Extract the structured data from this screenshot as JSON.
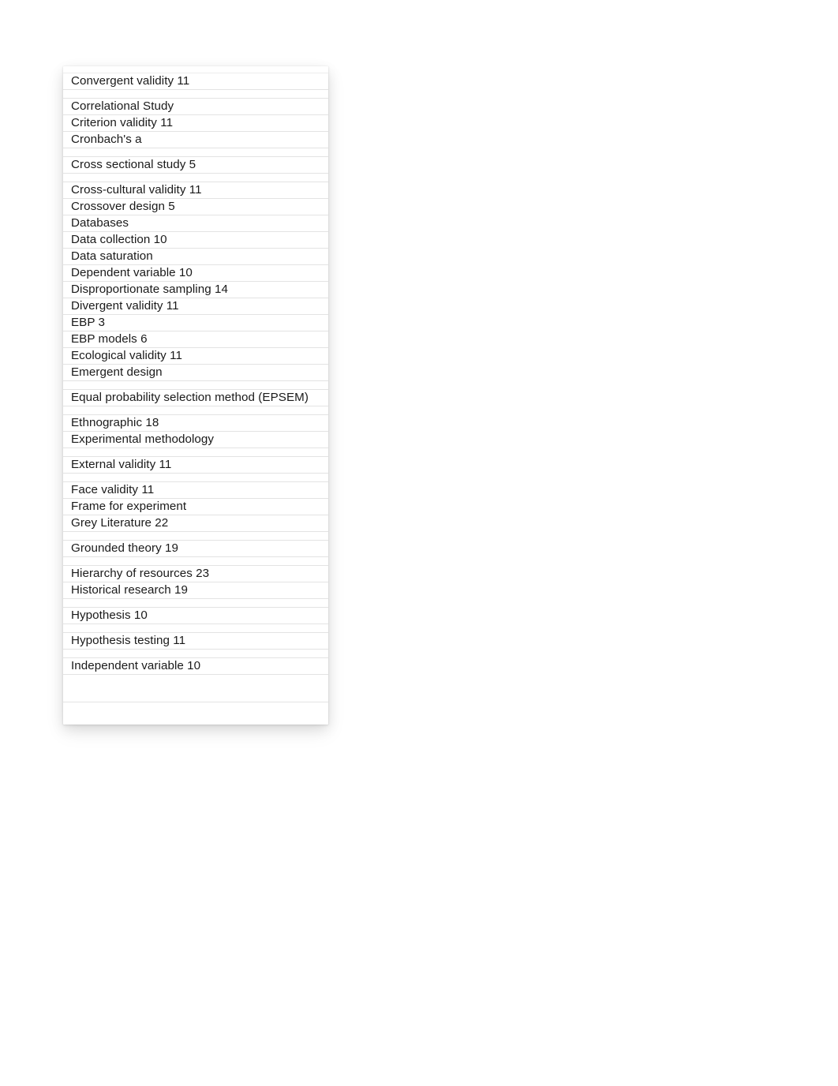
{
  "document": {
    "type": "index-table",
    "page_background": "#ffffff",
    "card_background": "#ffffff",
    "separator_color": "#e3e3e3",
    "text_color": "#1a1a1a"
  },
  "index": {
    "rows": [
      {
        "term": "Convergent validity 11",
        "spacing": "loose"
      },
      {
        "term": "",
        "spacing": "spacer"
      },
      {
        "term": "Correlational Study",
        "spacing": "normal"
      },
      {
        "term": "Criterion validity 11",
        "spacing": "tight"
      },
      {
        "term": "Cronbach's a",
        "spacing": "tight"
      },
      {
        "term": "",
        "spacing": "spacer"
      },
      {
        "term": "Cross sectional study 5",
        "spacing": "normal"
      },
      {
        "term": "",
        "spacing": "spacer"
      },
      {
        "term": "Cross-cultural validity 11",
        "spacing": "tight"
      },
      {
        "term": "Crossover design 5",
        "spacing": "tight"
      },
      {
        "term": "Databases",
        "spacing": "tight"
      },
      {
        "term": "Data collection 10",
        "spacing": "tight"
      },
      {
        "term": "Data saturation",
        "spacing": "tight"
      },
      {
        "term": "Dependent variable 10",
        "spacing": "tight"
      },
      {
        "term": "Disproportionate sampling 14",
        "spacing": "tight"
      },
      {
        "term": "Divergent validity 11",
        "spacing": "tight"
      },
      {
        "term": "EBP 3",
        "spacing": "tight"
      },
      {
        "term": "EBP models 6",
        "spacing": "tight"
      },
      {
        "term": "Ecological validity 11",
        "spacing": "tight"
      },
      {
        "term": "Emergent design",
        "spacing": "tight"
      },
      {
        "term": "",
        "spacing": "spacer"
      },
      {
        "term": "Equal probability selection method (EPSEM)",
        "spacing": "loose"
      },
      {
        "term": "",
        "spacing": "spacer"
      },
      {
        "term": "Ethnographic 18",
        "spacing": "normal"
      },
      {
        "term": "Experimental methodology",
        "spacing": "normal"
      },
      {
        "term": "",
        "spacing": "spacer"
      },
      {
        "term": "External validity 11",
        "spacing": "loose"
      },
      {
        "term": "",
        "spacing": "spacer"
      },
      {
        "term": "Face validity 11",
        "spacing": "tight"
      },
      {
        "term": "Frame for experiment",
        "spacing": "tight"
      },
      {
        "term": "Grey Literature 22",
        "spacing": "tight"
      },
      {
        "term": "",
        "spacing": "spacer"
      },
      {
        "term": "Grounded theory 19",
        "spacing": "normal"
      },
      {
        "term": "",
        "spacing": "spacer"
      },
      {
        "term": "Hierarchy of resources 23",
        "spacing": "tight"
      },
      {
        "term": "Historical research 19",
        "spacing": "tight"
      },
      {
        "term": "",
        "spacing": "spacer"
      },
      {
        "term": "Hypothesis 10",
        "spacing": "normal"
      },
      {
        "term": "",
        "spacing": "spacer"
      },
      {
        "term": "Hypothesis testing 11",
        "spacing": "normal"
      },
      {
        "term": "",
        "spacing": "spacer"
      },
      {
        "term": "Independent variable 10",
        "spacing": "loose"
      },
      {
        "term": "",
        "spacing": "tail"
      }
    ]
  }
}
